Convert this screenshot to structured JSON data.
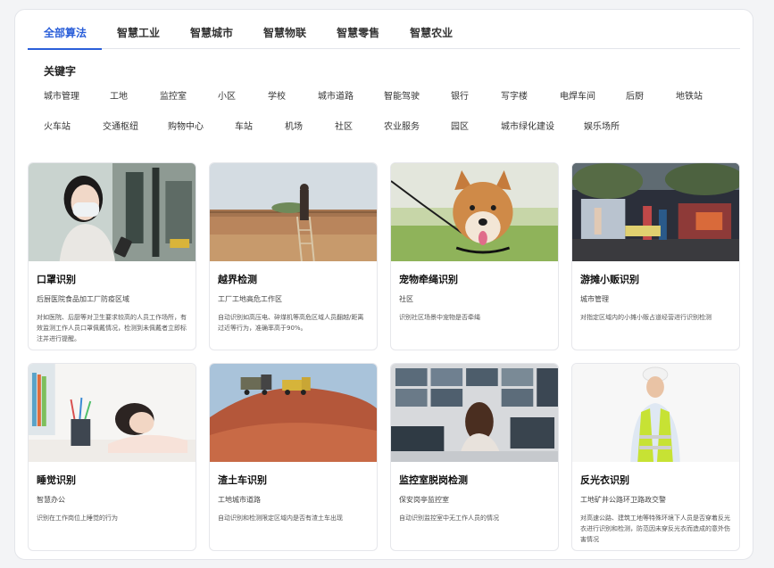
{
  "tabs": [
    {
      "label": "全部算法",
      "active": true
    },
    {
      "label": "智慧工业"
    },
    {
      "label": "智慧城市"
    },
    {
      "label": "智慧物联"
    },
    {
      "label": "智慧零售"
    },
    {
      "label": "智慧农业"
    }
  ],
  "keywords": {
    "title": "关键字",
    "row1": [
      "城市管理",
      "工地",
      "监控室",
      "小区",
      "学校",
      "城市道路",
      "智能驾驶",
      "银行",
      "写字楼",
      "电焊车间",
      "后厨",
      "地铁站"
    ],
    "row2": [
      "火车站",
      "交通枢纽",
      "购物中心",
      "车站",
      "机场",
      "社区",
      "农业服务",
      "园区",
      "城市绿化建设",
      "娱乐场所"
    ]
  },
  "cards": [
    {
      "title": "口罩识别",
      "scene": "后厨医院食品加工厂防疫区域",
      "desc": "对如医院、后厨等对卫生要求较高的人员工作场所，有效监测工作人员口罩佩戴情况，检测到未佩戴者立即标注并进行提醒。"
    },
    {
      "title": "越界检测",
      "scene": "工厂工地高危工作区",
      "desc": "自动识别如高压电、碎煤机等高危区域人员翻越/距离过近等行为，准确率高于90%。"
    },
    {
      "title": "宠物牵绳识别",
      "scene": "社区",
      "desc": "识别社区场景中宠物是否牵绳"
    },
    {
      "title": "游摊小贩识别",
      "scene": "城市管理",
      "desc": "对指定区域内的小摊小贩占道经营进行识别检测"
    },
    {
      "title": "睡觉识别",
      "scene": "智慧办公",
      "desc": "识别在工作岗位上睡觉的行为"
    },
    {
      "title": "渣土车识别",
      "scene": "工地城市道路",
      "desc": "自动识别和检测限定区域内是否有渣土车出现"
    },
    {
      "title": "监控室脱岗检测",
      "scene": "保安岗亭监控室",
      "desc": "自动识别监控室中无工作人员的情况"
    },
    {
      "title": "反光衣识别",
      "scene": "工地矿井公路环卫路政交警",
      "desc": "对高速公路、建筑工地等特殊环境下人员是否穿着反光衣进行识别和检测，防范因未穿反光衣而造成的意外伤害情况"
    }
  ]
}
